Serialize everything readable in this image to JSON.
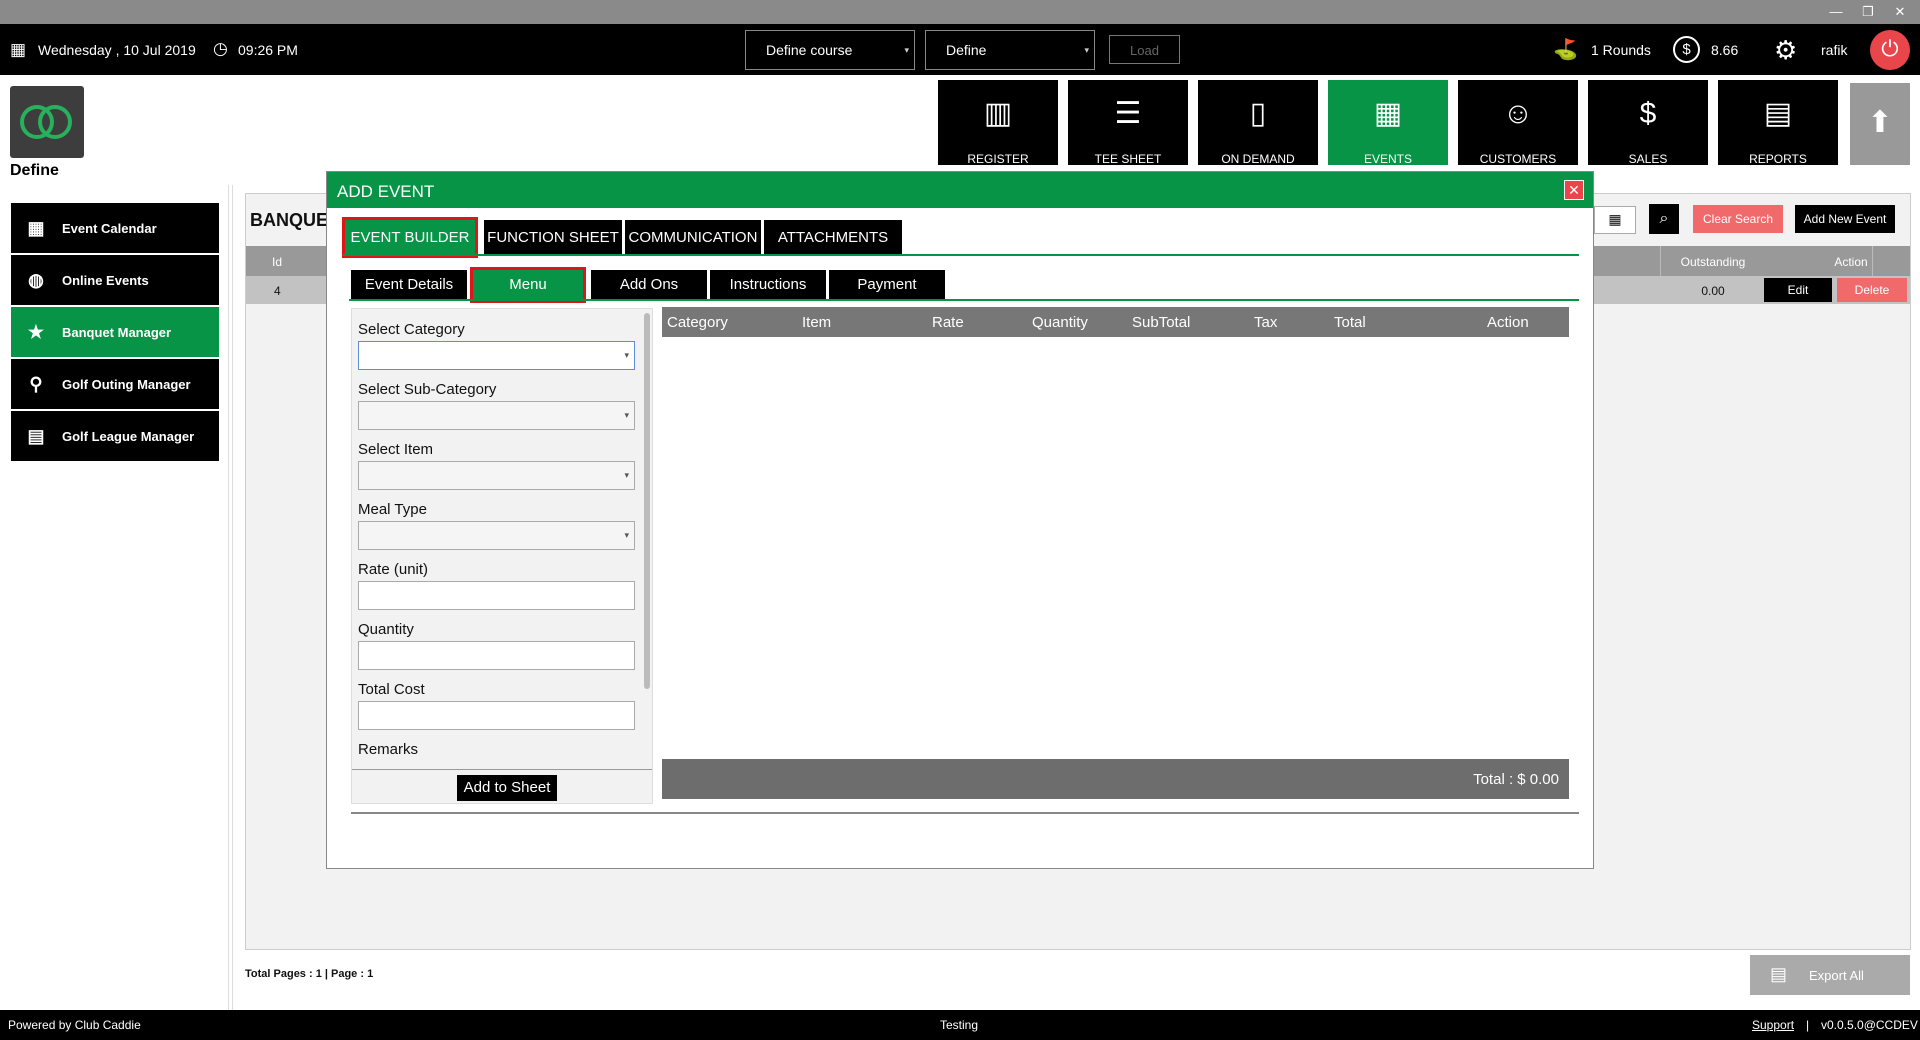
{
  "window": {
    "controls": [
      "—",
      "❐",
      "✕"
    ]
  },
  "topbar": {
    "date": "Wednesday ,  10 Jul 2019",
    "time": "09:26 PM",
    "course_select": "Define course",
    "define_select": "Define",
    "load_label": "Load",
    "rounds": "1 Rounds",
    "balance": "8.66",
    "user": "rafik"
  },
  "logo": {
    "label": "Define"
  },
  "modules": [
    {
      "label": "REGISTER",
      "icon": "barcode-scanner-icon"
    },
    {
      "label": "TEE SHEET",
      "icon": "list-icon"
    },
    {
      "label": "ON DEMAND",
      "icon": "mobile-icon"
    },
    {
      "label": "EVENTS",
      "icon": "calendar-icon"
    },
    {
      "label": "CUSTOMERS",
      "icon": "users-icon"
    },
    {
      "label": "SALES",
      "icon": "money-icon"
    },
    {
      "label": "REPORTS",
      "icon": "chart-icon"
    }
  ],
  "sidebar": {
    "items": [
      {
        "label": "Event Calendar"
      },
      {
        "label": "Online Events"
      },
      {
        "label": "Banquet Manager"
      },
      {
        "label": "Golf Outing Manager"
      },
      {
        "label": "Golf League Manager"
      }
    ]
  },
  "main": {
    "title": "BANQUE",
    "clear_search": "Clear Search",
    "add_new_event": "Add New Event",
    "columns": {
      "id": "Id",
      "outstanding": "Outstanding",
      "action": "Action"
    },
    "row": {
      "id": "4",
      "outstanding": "0.00",
      "edit": "Edit",
      "delete": "Delete"
    },
    "pages": "Total Pages : 1 | Page : 1",
    "export_all": "Export All"
  },
  "modal": {
    "title": "ADD EVENT",
    "tabs": [
      "EVENT BUILDER",
      "FUNCTION SHEET",
      "COMMUNICATION",
      "ATTACHMENTS"
    ],
    "subtabs": [
      "Event Details",
      "Menu",
      "Add Ons",
      "Instructions",
      "Payment"
    ],
    "form": {
      "select_category": "Select Category",
      "select_subcategory": "Select Sub-Category",
      "select_item": "Select Item",
      "meal_type": "Meal Type",
      "rate": "Rate (unit)",
      "quantity": "Quantity",
      "total_cost": "Total Cost",
      "remarks": "Remarks",
      "add_to_sheet": "Add to Sheet"
    },
    "table": {
      "columns": [
        "Category",
        "Item",
        "Rate",
        "Quantity",
        "SubTotal",
        "Tax",
        "Total",
        "Action"
      ],
      "total_label": "Total :  $ 0.00"
    }
  },
  "footer": {
    "powered": "Powered by Club Caddie",
    "env": "Testing",
    "support": "Support",
    "version": "v0.0.5.0@CCDEV"
  },
  "colors": {
    "accent": "#079446",
    "danger": "#f0696b",
    "highlight": "#e1141a"
  }
}
